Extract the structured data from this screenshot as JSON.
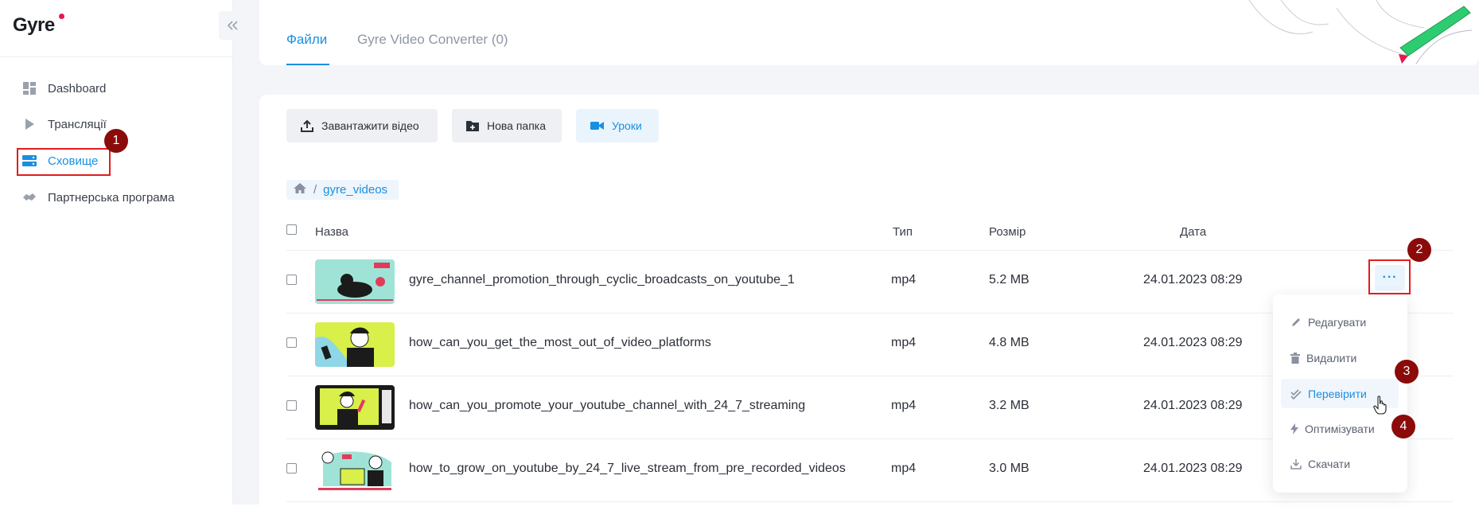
{
  "app": {
    "logo": "Gyre"
  },
  "sidebar": {
    "items": [
      {
        "label": "Dashboard",
        "icon": "dashboard-icon"
      },
      {
        "label": "Трансляції",
        "icon": "play-icon"
      },
      {
        "label": "Сховище",
        "icon": "storage-icon",
        "active": true
      },
      {
        "label": "Партнерська програма",
        "icon": "handshake-icon"
      }
    ]
  },
  "tabs": [
    {
      "label": "Файли",
      "active": true
    },
    {
      "label": "Gyre Video Converter (0)"
    }
  ],
  "toolbar": {
    "upload_label": "Завантажити відео",
    "new_folder_label": "Нова папка",
    "lessons_label": "Уроки"
  },
  "breadcrumb": {
    "folder": "gyre_videos",
    "separator": "/"
  },
  "table": {
    "columns": {
      "name": "Назва",
      "type": "Тип",
      "size": "Розмір",
      "date": "Дата"
    },
    "rows": [
      {
        "name": "gyre_channel_promotion_through_cyclic_broadcasts_on_youtube_1",
        "type": "mp4",
        "size": "5.2 MB",
        "date": "24.01.2023 08:29"
      },
      {
        "name": "how_can_you_get_the_most_out_of_video_platforms",
        "type": "mp4",
        "size": "4.8 MB",
        "date": "24.01.2023 08:29"
      },
      {
        "name": "how_can_you_promote_your_youtube_channel_with_24_7_streaming",
        "type": "mp4",
        "size": "3.2 MB",
        "date": "24.01.2023 08:29"
      },
      {
        "name": "how_to_grow_on_youtube_by_24_7_live_stream_from_pre_recorded_videos",
        "type": "mp4",
        "size": "3.0 MB",
        "date": "24.01.2023 08:29"
      }
    ]
  },
  "row_actions": {
    "more_label": "···"
  },
  "context_menu": {
    "items": [
      {
        "label": "Редагувати",
        "icon": "pencil-icon"
      },
      {
        "label": "Видалити",
        "icon": "trash-icon"
      },
      {
        "label": "Перевірити",
        "icon": "double-check-icon",
        "hover": true
      },
      {
        "label": "Оптимізувати",
        "icon": "bolt-icon"
      },
      {
        "label": "Скачати",
        "icon": "download-icon"
      }
    ]
  },
  "callouts": [
    "1",
    "2",
    "3",
    "4"
  ],
  "colors": {
    "accent": "#1a8fe0",
    "callout": "#8b0b0b",
    "highlight": "#e11d1d",
    "brand_dot": "#e6194b"
  }
}
